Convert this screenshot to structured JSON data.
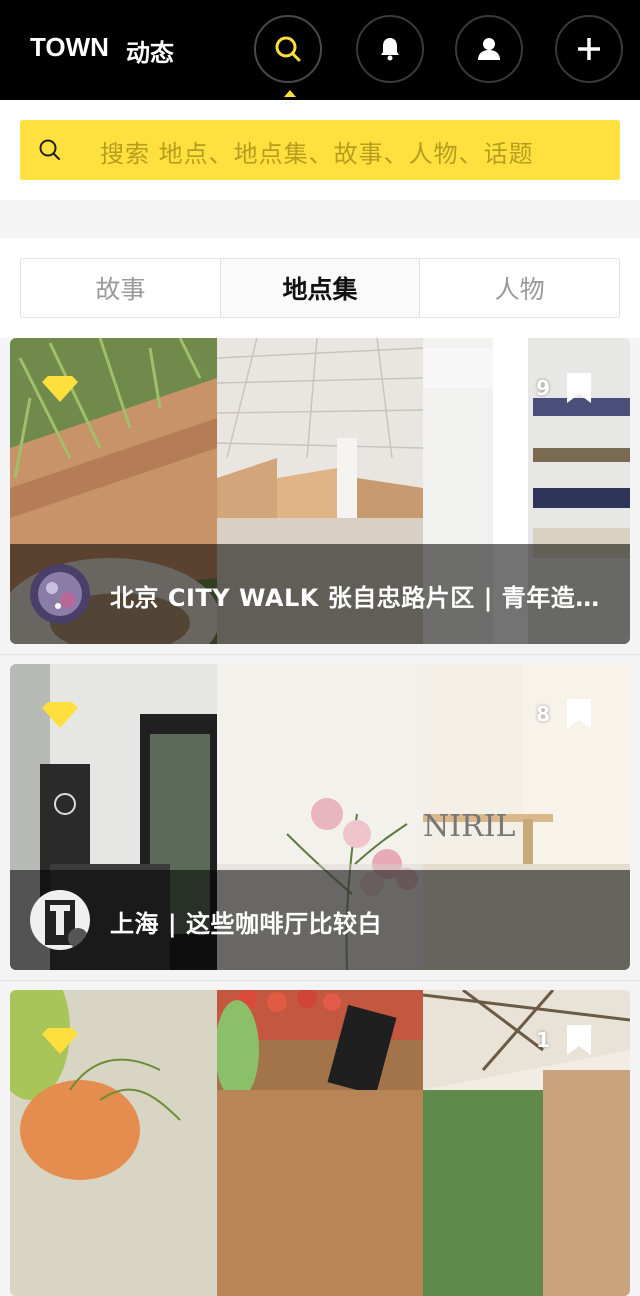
{
  "nav": {
    "brand": "TOWN",
    "feed": "动态",
    "icons": [
      "search-icon",
      "bell-icon",
      "user-icon",
      "plus-icon"
    ],
    "accent_color": "#ffdf3d"
  },
  "search": {
    "placeholder": "搜索 地点、地点集、故事、人物、话题"
  },
  "tabs": [
    {
      "label": "故事"
    },
    {
      "label": "地点集",
      "selected": true
    },
    {
      "label": "人物"
    }
  ],
  "cards": [
    {
      "title": "北京 CITY WALK 张自忠路片区 | 青年造物空间",
      "count": "9",
      "badge": "diamond-icon"
    },
    {
      "title": "上海 | 这些咖啡厅比较白",
      "count": "8",
      "badge": "diamond-icon"
    },
    {
      "title": "",
      "count": "1",
      "badge": "diamond-icon"
    }
  ]
}
